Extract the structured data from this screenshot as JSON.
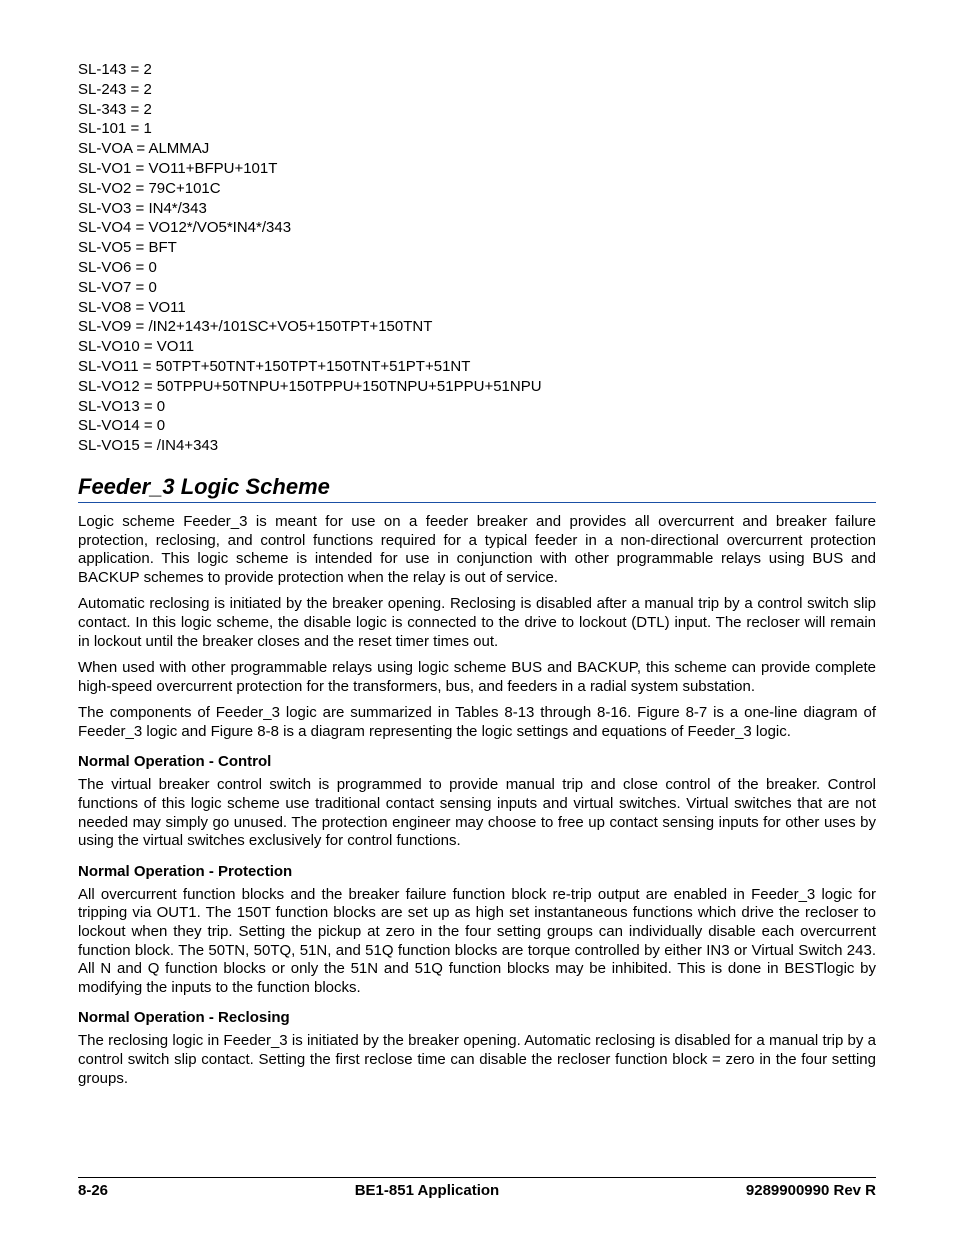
{
  "code_lines": [
    "SL-143 = 2",
    "SL-243 = 2",
    "SL-343 = 2",
    "SL-101 = 1",
    "SL-VOA = ALMMAJ",
    "SL-VO1 = VO11+BFPU+101T",
    "SL-VO2 = 79C+101C",
    "SL-VO3 = IN4*/343",
    "SL-VO4 = VO12*/VO5*IN4*/343",
    "SL-VO5 = BFT",
    "SL-VO6 = 0",
    "SL-VO7 = 0",
    "SL-VO8 = VO11",
    "SL-VO9 = /IN2+143+/101SC+VO5+150TPT+150TNT",
    "SL-VO10 = VO11",
    "SL-VO11 = 50TPT+50TNT+150TPT+150TNT+51PT+51NT",
    "SL-VO12 = 50TPPU+50TNPU+150TPPU+150TNPU+51PPU+51NPU",
    "SL-VO13 = 0",
    "SL-VO14 = 0",
    "SL-VO15 = /IN4+343"
  ],
  "section": {
    "title": "Feeder_3 Logic Scheme",
    "paragraphs": [
      "Logic scheme Feeder_3 is meant for use on a feeder breaker and provides all overcurrent and breaker failure protection, reclosing, and control functions required for a typical feeder in a non-directional overcurrent protection application. This logic scheme is intended for use in conjunction with other programmable relays using BUS and BACKUP schemes to provide protection when the relay is out of service.",
      "Automatic reclosing is initiated by the breaker opening. Reclosing is disabled after a manual trip by a control switch slip contact. In this logic scheme, the disable logic is connected to the drive to lockout (DTL) input. The recloser will remain in lockout until the breaker closes and the reset timer times out.",
      "When used with other programmable relays using logic scheme BUS and BACKUP, this scheme can provide complete high-speed overcurrent protection for the transformers, bus, and feeders in a radial system substation.",
      "The components of Feeder_3 logic are summarized in Tables 8-13 through 8-16. Figure 8-7 is a one-line diagram of Feeder_3 logic and Figure 8-8 is a diagram representing the logic settings and equations of Feeder_3 logic."
    ],
    "subsections": [
      {
        "heading": "Normal Operation - Control",
        "text": "The virtual breaker control switch is programmed to provide manual trip and close control of the breaker. Control functions of this logic scheme use traditional contact sensing inputs and virtual switches. Virtual switches that are not needed may simply go unused. The protection engineer may choose to free up contact sensing inputs for other uses by using the virtual switches exclusively for control functions."
      },
      {
        "heading": "Normal Operation - Protection",
        "text": "All overcurrent function blocks and the breaker failure function block re-trip output are enabled in Feeder_3 logic for tripping via OUT1. The 150T function blocks are set up as high set instantaneous functions which drive the recloser to lockout when they trip. Setting the pickup at zero in the four setting groups can individually disable each overcurrent function block. The 50TN, 50TQ, 51N, and 51Q function blocks are torque controlled by either IN3 or Virtual Switch 243. All N and Q function blocks or only the 51N and 51Q function blocks may be inhibited. This is done in BESTlogic by modifying the inputs to the function blocks."
      },
      {
        "heading": "Normal Operation - Reclosing",
        "text": "The reclosing logic in Feeder_3 is initiated by the breaker opening. Automatic reclosing is disabled for a manual trip by a control switch slip contact. Setting the first reclose time can disable the recloser function block = zero in the four setting groups."
      }
    ]
  },
  "footer": {
    "left": "8-26",
    "center": "BE1-851 Application",
    "right": "9289900990 Rev R"
  }
}
